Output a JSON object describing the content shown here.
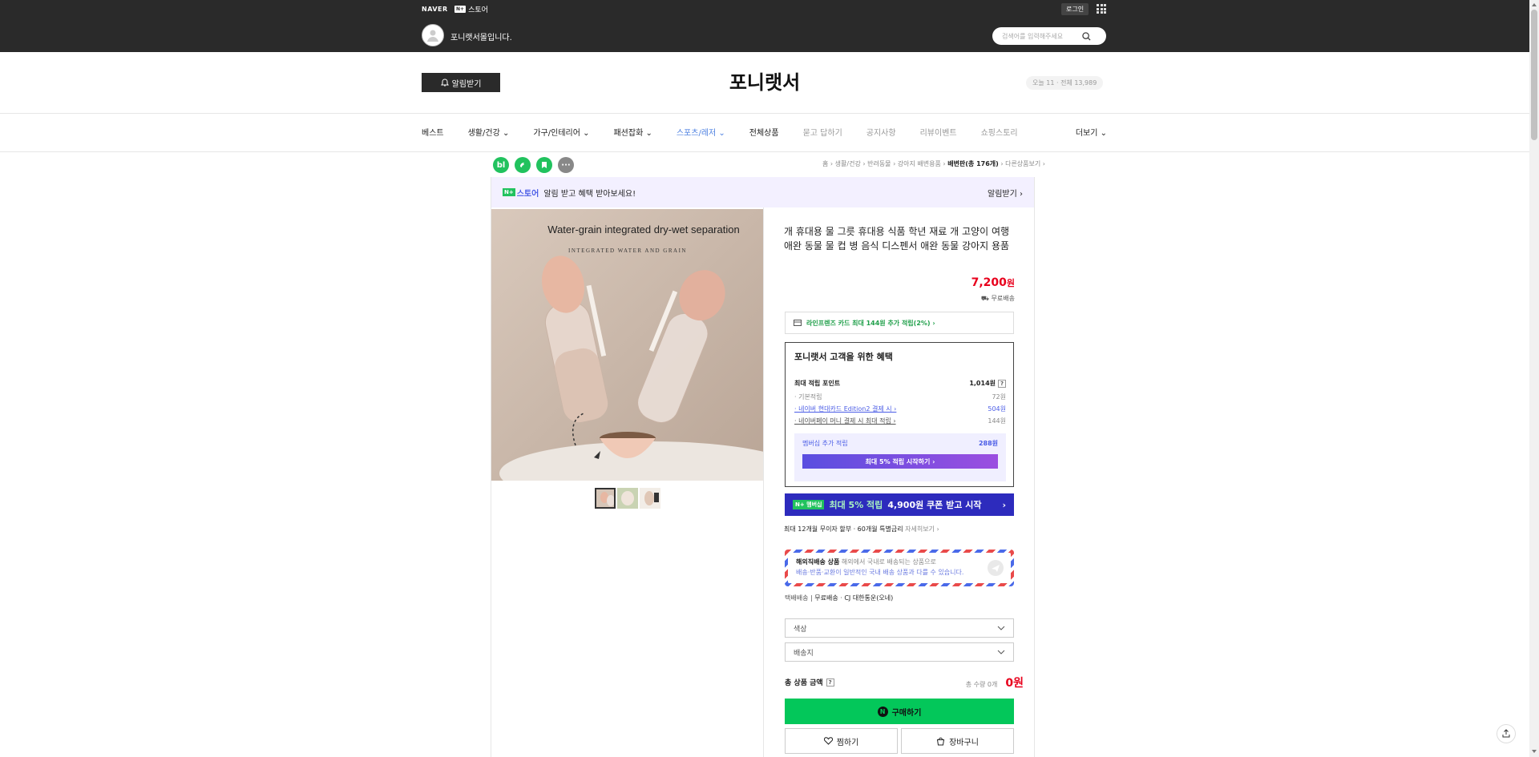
{
  "topbar": {
    "naver": "NAVER",
    "nstore_badge": "N+",
    "nstore_label": "스토어",
    "login": "로그인",
    "store_name": "포니랫서몰입니다.",
    "search_placeholder": "검색어를 입력해주세요"
  },
  "header": {
    "alarm_label": "알림받기",
    "store_title": "포니랫서",
    "visit_text": "오늘 11 · 전체 13,989"
  },
  "nav": {
    "items": [
      {
        "label": "베스트"
      },
      {
        "label": "생활/건강 ⌄"
      },
      {
        "label": "가구/인테리어 ⌄"
      },
      {
        "label": "패션잡화 ⌄"
      },
      {
        "label": "스포츠/레저 ⌄"
      },
      {
        "label": "전체상품"
      },
      {
        "label": "묻고 답하기"
      },
      {
        "label": "공지사항"
      },
      {
        "label": "리뷰이벤트"
      },
      {
        "label": "쇼핑스토리"
      }
    ],
    "more": "더보기 ⌄"
  },
  "share": {
    "blog": "bl",
    "more": "···"
  },
  "breadcrumb": {
    "path": "홈 › 생활/건강 › 반려동물 › 강아지 배변용품 ›",
    "current": "배변판(총 176개)",
    "other": "› 다른상품보기 ›"
  },
  "promo": {
    "badge": "N+",
    "store_word": "스토어",
    "text": "알림 받고 혜택 받아보세요!",
    "right": "알림받기 ›"
  },
  "image": {
    "caption": "Water-grain integrated dry-wet separation",
    "subcaption": "INTEGRATED WATER AND GRAIN"
  },
  "product": {
    "title": "개 휴대용 물 그릇 휴대용 식품 학년 재료 개 고양이 여행 애완 동물 물 컵 병 음식 디스펜서 애완 동물 강아지 용품",
    "price": "7,200",
    "price_unit": "원",
    "shipping": "무료배송",
    "card_benefit": "라인프렌즈 카드 최대 144원 추가 적립(2%) ›"
  },
  "benefit": {
    "title": "포니랫서 고객을 위한 혜택",
    "max_label": "최대 적립 포인트",
    "max_value": "1,014원",
    "rows": [
      {
        "label": "· 기본적립",
        "value": "72원"
      },
      {
        "label": "· 네이버 현대카드 Edition2 결제 시 ›",
        "value": "504원"
      },
      {
        "label": "· 네이버페이 머니 결제 시 최대 적립 ›",
        "value": "144원"
      }
    ],
    "membership_label": "멤버십 추가 적립",
    "membership_value": "288원",
    "membership_btn": "최대 5% 적립 시작하기 ›"
  },
  "banner": {
    "tag": "N+ 멤버십",
    "highlight": "최대 5% 적립",
    "text": "4,900원 쿠폰 받고 시작",
    "arrow": "›"
  },
  "installment": {
    "text": "최대 12개월 무이자 할부 · 60개월 특별금리",
    "more": "자세히보기 ›"
  },
  "overseas": {
    "title": "해외직배송 상품",
    "desc": "해외에서 국내로 배송되는 상품으로",
    "desc2": "배송·반품·교환이 일반적인 국내 배송 상품과 다를 수 있습니다."
  },
  "delivery": {
    "type": "택배배송",
    "fee": "무료배송",
    "carrier": "CJ 대한통운(오네)"
  },
  "options": {
    "color": "색상",
    "ship_from": "배송지"
  },
  "total": {
    "label": "총 상품 금액",
    "qty": "총 수량 0개",
    "amount": "0원"
  },
  "actions": {
    "buy": "구매하기",
    "wish": "찜하기",
    "cart": "장바구니"
  },
  "colors": {
    "naver_green": "#03c75a",
    "price_red": "#e8001c",
    "accent_blue": "#4a5ce6"
  }
}
